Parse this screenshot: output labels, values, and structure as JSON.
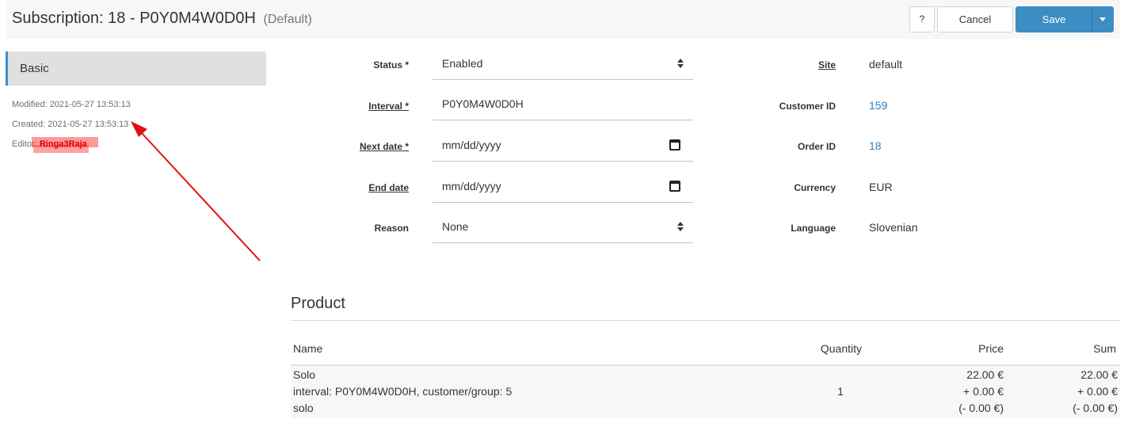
{
  "header": {
    "title": "Subscription: 18 - P0Y0M4W0D0H",
    "subtitle": "(Default)",
    "help_label": "?",
    "cancel_label": "Cancel",
    "save_label": "Save"
  },
  "sidebar": {
    "tab_label": "Basic",
    "modified": "Modified: 2021-05-27 13:53:13",
    "created": "Created: 2021-05-27 13:53:13",
    "editor_label": "Editor:",
    "editor_value": "Ringa3Raja"
  },
  "form": {
    "status": {
      "label": "Status *",
      "value": "Enabled"
    },
    "interval": {
      "label": "Interval *",
      "value": "P0Y0M4W0D0H"
    },
    "next_date": {
      "label": "Next date *",
      "placeholder": "mm/dd/yyyy"
    },
    "end_date": {
      "label": "End date",
      "placeholder": "mm/dd/yyyy"
    },
    "reason": {
      "label": "Reason",
      "value": "None"
    }
  },
  "info": {
    "site": {
      "label": "Site",
      "value": "default"
    },
    "customer_id": {
      "label": "Customer ID",
      "value": "159"
    },
    "order_id": {
      "label": "Order ID",
      "value": "18"
    },
    "currency": {
      "label": "Currency",
      "value": "EUR"
    },
    "language": {
      "label": "Language",
      "value": "Slovenian"
    }
  },
  "product": {
    "title": "Product",
    "columns": {
      "name": "Name",
      "quantity": "Quantity",
      "price": "Price",
      "sum": "Sum"
    },
    "row": {
      "name_line1": "Solo",
      "name_line2": "interval: P0Y0M4W0D0H, customer/group: 5",
      "name_line3": "solo",
      "quantity": "1",
      "price_line1": "22.00 €",
      "price_line2": "+ 0.00 €",
      "price_line3": "(- 0.00 €)",
      "sum_line1": "22.00 €",
      "sum_line2": "+ 0.00 €",
      "sum_line3": "(- 0.00 €)"
    }
  },
  "colors": {
    "accent": "#3c8dc3",
    "link": "#2a7dbf",
    "annotation": "#e01010"
  }
}
